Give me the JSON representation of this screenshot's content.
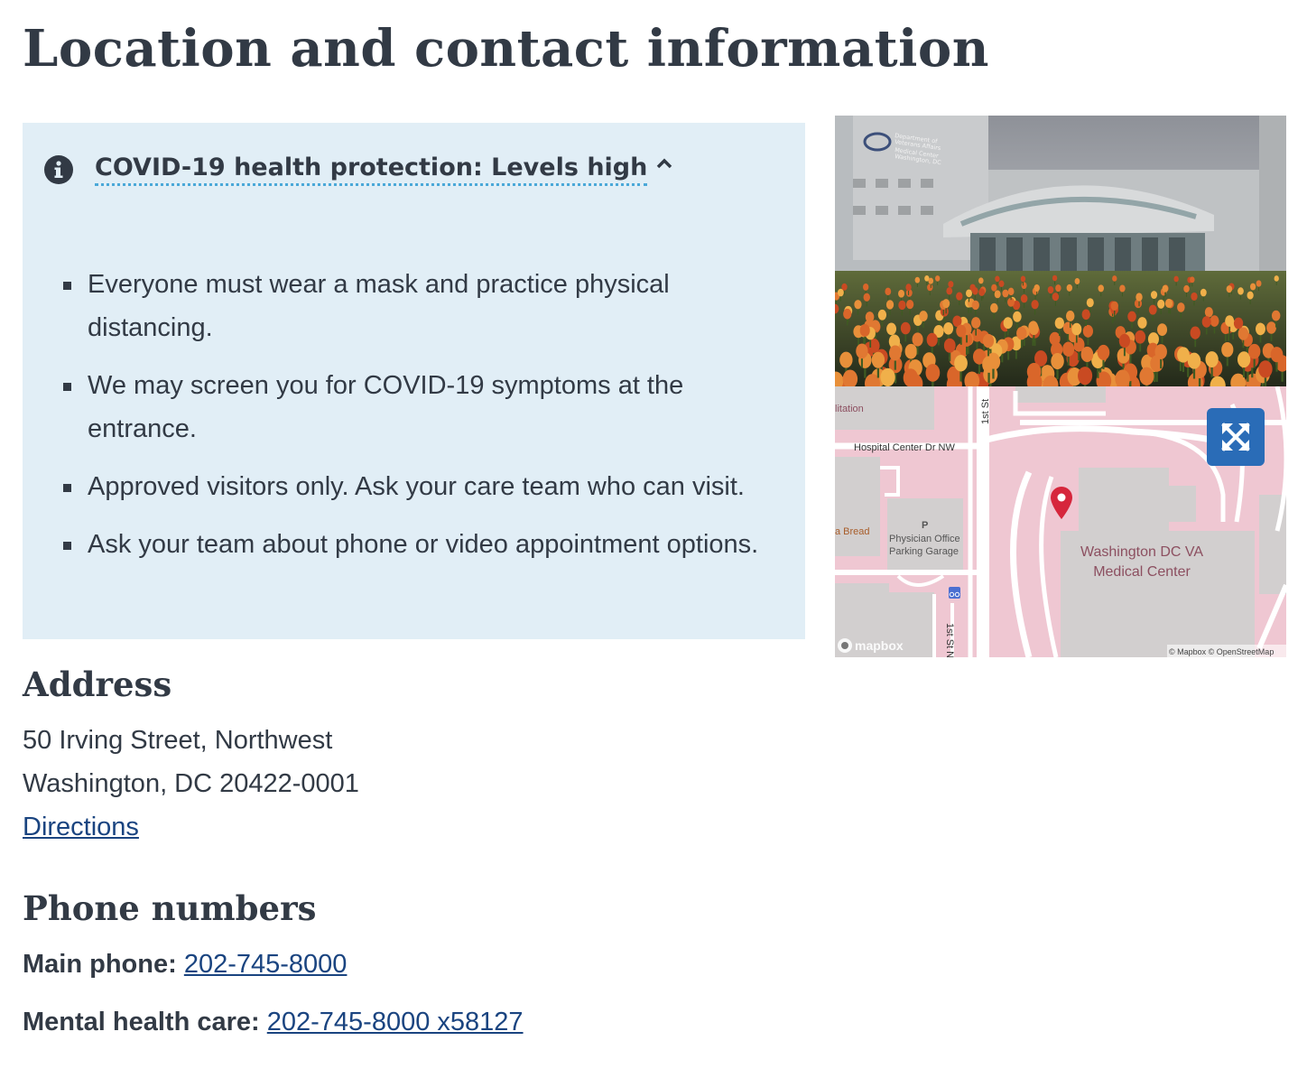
{
  "page": {
    "title": "Location and contact information"
  },
  "covid": {
    "heading": "COVID-19 health protection: Levels high",
    "rules": [
      "Everyone must wear a mask and practice physical distancing.",
      "We may screen you for COVID-19 symptoms at the entrance.",
      "Approved visitors only. Ask your care team who can visit.",
      "Ask your team about phone or video appointment options."
    ],
    "icon": "info-circle-icon",
    "toggle_icon": "chevron-up-icon"
  },
  "photo": {
    "sign_text": [
      "Department of",
      "Veterans Affairs",
      "Medical Center",
      "Washington, DC"
    ]
  },
  "map": {
    "labels": {
      "facility_line1": "Washington DC VA",
      "facility_line2": "Medical Center",
      "garage_line1": "Physician Office",
      "garage_line2": "Parking Garage",
      "street_hospital": "Hospital Center Dr NW",
      "street_1st_top": "1st St",
      "street_1st_bottom": "1st St NW",
      "bread": "a Bread",
      "litation": "litation",
      "mapbox": "mapbox",
      "attribution": "© Mapbox © OpenStreetMap",
      "parking_symbol": "P"
    },
    "expand_icon": "expand-arrows-icon",
    "pin_icon": "map-pin-icon"
  },
  "address": {
    "heading": "Address",
    "line1": "50 Irving Street, Northwest",
    "line2": "Washington, DC 20422-0001",
    "directions": "Directions"
  },
  "phones": {
    "heading": "Phone numbers",
    "main_label": "Main phone:",
    "main_value": "202-745-8000",
    "mental_label": "Mental health care:",
    "mental_value": "202-745-8000 x58127"
  },
  "colors": {
    "text": "#323a45",
    "alert_bg": "#e1eef6",
    "link": "#1a4480",
    "map_button": "#2a6cb7",
    "pin": "#d6263c"
  }
}
